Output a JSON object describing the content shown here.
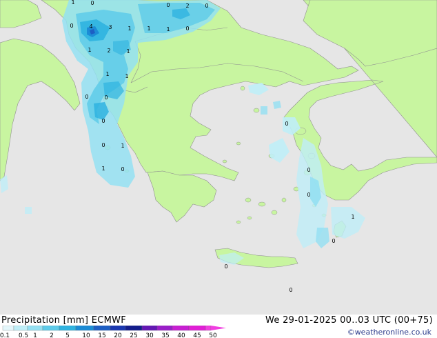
{
  "header": {
    "title": "Precipitation [mm] ECMWF",
    "datetime": "We 29-01-2025 00..03 UTC (00+75)",
    "credit": "©weatheronline.co.uk"
  },
  "legend": {
    "ticks": [
      "0.1",
      "0.5",
      "1",
      "2",
      "5",
      "10",
      "15",
      "20",
      "25",
      "30",
      "35",
      "40",
      "45",
      "50"
    ],
    "colors": [
      "#e4f7fb",
      "#bfeef7",
      "#94e0f2",
      "#5ecbe9",
      "#2fb3e0",
      "#1c8cd6",
      "#1d5fc4",
      "#1a38b0",
      "#131d8c",
      "#6418b4",
      "#9a1ec9",
      "#c81fd2",
      "#e11fd6",
      "#f03fe0"
    ]
  },
  "map": {
    "value_labels": [
      "1",
      "0",
      "0",
      "2",
      "0",
      "0",
      "4",
      "3",
      "1",
      "1",
      "1",
      "1",
      "2",
      "1",
      "1",
      "1",
      "0",
      "0",
      "0",
      "1",
      "0",
      "1",
      "0",
      "0",
      "0",
      "0",
      "1",
      "0",
      "0",
      "0",
      "0"
    ],
    "colors": {
      "sea": "#e6e6e6",
      "land": "#c8f5a0",
      "border": "#909090"
    }
  }
}
